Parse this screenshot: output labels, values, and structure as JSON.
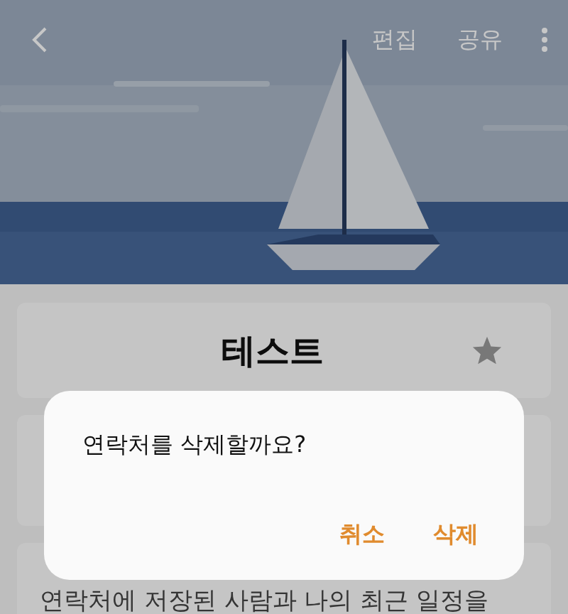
{
  "toolbar": {
    "actions": [
      "편집",
      "공유"
    ]
  },
  "contact": {
    "name": "테스트"
  },
  "info_card": {
    "text": "연락처에 저장된 사람과 나의 최근 일정을"
  },
  "dialog": {
    "message": "연락처를 삭제할까요?",
    "buttons": [
      "취소",
      "삭제"
    ]
  }
}
